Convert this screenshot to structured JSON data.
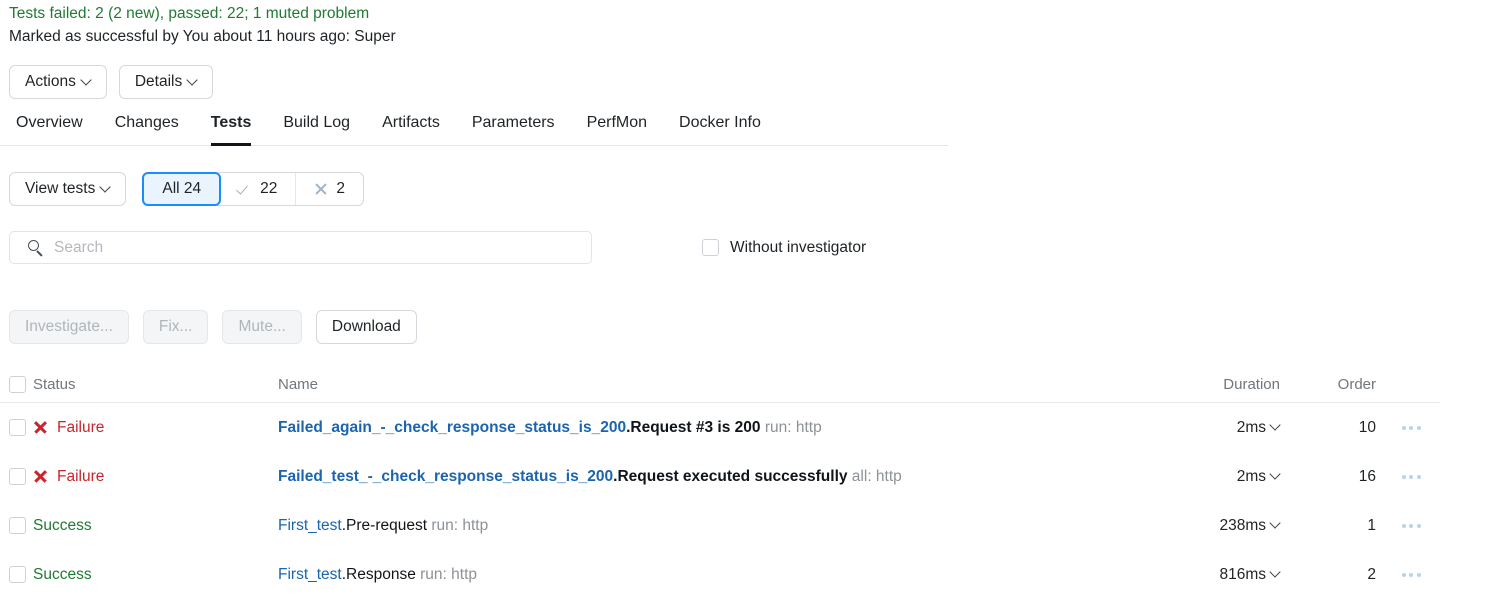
{
  "summary": {
    "status_line": "Tests failed: 2 (2 new), passed: 22; 1 muted problem",
    "marked_line": "Marked as successful by You about 11 hours ago: Super"
  },
  "toolbar": {
    "actions_label": "Actions",
    "details_label": "Details"
  },
  "tabs": [
    {
      "label": "Overview",
      "active": false
    },
    {
      "label": "Changes",
      "active": false
    },
    {
      "label": "Tests",
      "active": true
    },
    {
      "label": "Build Log",
      "active": false
    },
    {
      "label": "Artifacts",
      "active": false
    },
    {
      "label": "Parameters",
      "active": false
    },
    {
      "label": "PerfMon",
      "active": false
    },
    {
      "label": "Docker Info",
      "active": false
    }
  ],
  "filters": {
    "view_tests_label": "View tests",
    "all_label": "All 24",
    "passed_count": "22",
    "failed_count": "2"
  },
  "search": {
    "placeholder": "Search",
    "value": "",
    "without_investigator_label": "Without investigator",
    "without_investigator_checked": false
  },
  "actions": {
    "investigate_label": "Investigate...",
    "fix_label": "Fix...",
    "mute_label": "Mute...",
    "download_label": "Download"
  },
  "table": {
    "headers": {
      "status": "Status",
      "name": "Name",
      "duration": "Duration",
      "order": "Order"
    },
    "rows": [
      {
        "status": "Failure",
        "status_type": "failure",
        "name_prefix": "Failed_again_-_check_response_status_is_200",
        "name_suffix": ".Request #3 is 200",
        "name_meta": " run: http",
        "bold": true,
        "duration": "2ms",
        "order": "10"
      },
      {
        "status": "Failure",
        "status_type": "failure",
        "name_prefix": "Failed_test_-_check_response_status_is_200",
        "name_suffix": ".Request executed successfully",
        "name_meta": " all: http",
        "bold": true,
        "duration": "2ms",
        "order": "16"
      },
      {
        "status": "Success",
        "status_type": "success",
        "name_prefix": "First_test",
        "name_suffix": ".Pre-request",
        "name_meta": " run: http",
        "bold": false,
        "duration": "238ms",
        "order": "1"
      },
      {
        "status": "Success",
        "status_type": "success",
        "name_prefix": "First_test",
        "name_suffix": ".Response",
        "name_meta": " run: http",
        "bold": false,
        "duration": "816ms",
        "order": "2"
      }
    ]
  },
  "colors": {
    "success": "#1f7a33",
    "failure": "#c9252c",
    "link": "#1a64b0",
    "accent": "#1a8cff"
  }
}
